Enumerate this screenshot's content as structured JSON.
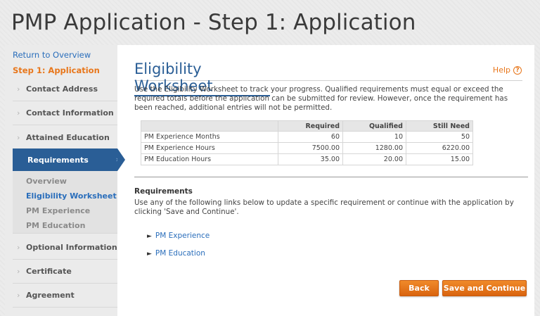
{
  "page_title": "PMP Application - Step 1: Application",
  "sidebar": {
    "return_link": "Return to Overview",
    "step_label": "Step 1: Application",
    "items": [
      {
        "label": "Contact Address"
      },
      {
        "label": "Contact Information"
      },
      {
        "label": "Attained Education"
      },
      {
        "label": "Requirements",
        "active": true
      },
      {
        "label": "Optional Information"
      },
      {
        "label": "Certificate"
      },
      {
        "label": "Agreement"
      }
    ],
    "subitems": [
      {
        "label": "Overview"
      },
      {
        "label": "Eligibility Worksheet",
        "current": true
      },
      {
        "label": "PM Experience"
      },
      {
        "label": "PM Education"
      }
    ],
    "chevron": "›"
  },
  "main": {
    "title": "Eligibility Worksheet",
    "help_label": "Help",
    "help_icon": "?",
    "intro": "Use the Eligibility Worksheet to track your progress. Qualified requirements must equal or exceed the required totals before the application can be submitted for review. However, once the requirement has been reached, additional entries will not be permitted.",
    "table": {
      "headers": [
        "",
        "Required",
        "Qualified",
        "Still Need"
      ],
      "rows": [
        [
          "PM Experience Months",
          "60",
          "10",
          "50"
        ],
        [
          "PM Experience Hours",
          "7500.00",
          "1280.00",
          "6220.00"
        ],
        [
          "PM Education Hours",
          "35.00",
          "20.00",
          "15.00"
        ]
      ]
    },
    "requirements_heading": "Requirements",
    "requirements_text": "Use any of the following links below to update a specific requirement or continue with the application by clicking 'Save and Continue'.",
    "links": [
      {
        "label": "PM Experience"
      },
      {
        "label": "PM Education"
      }
    ],
    "back_label": "Back",
    "save_label": "Save and Continue"
  },
  "colors": {
    "accent_blue": "#2a5e96",
    "link_blue": "#2a6ebb",
    "accent_orange": "#e8761a"
  }
}
